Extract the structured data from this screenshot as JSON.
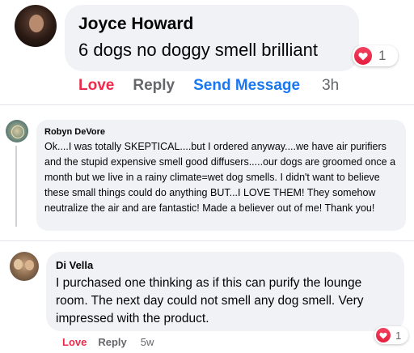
{
  "comments": [
    {
      "author": "Joyce Howard",
      "text": "6 dogs no doggy smell brilliant",
      "reaction_count": "1",
      "actions": {
        "love": "Love",
        "reply": "Reply",
        "send_message": "Send Message",
        "time": "3h"
      }
    },
    {
      "author": "Robyn DeVore",
      "text": "Ok....I was totally SKEPTICAL....but I ordered anyway....we have air purifiers and the stupid expensive smell good diffusers.....our dogs are groomed once a month but we live in a rainy climate=wet dog smells. I didn't want to believe these small things could do anything BUT...I LOVE THEM! They somehow neutralize the air and are fantastic! Made a believer out of me! Thank you!"
    },
    {
      "author": "Di Vella",
      "text": "I purchased one thinking as if this can purify the lounge room. The next day could not smell any dog smell. Very impressed with the product.",
      "reaction_count": "1",
      "actions": {
        "love": "Love",
        "reply": "Reply",
        "time": "5w"
      }
    }
  ],
  "colors": {
    "love": "#f02849",
    "link": "#1877f2",
    "secondary": "#65676b",
    "bubble": "#f0f2f5"
  },
  "icons": {
    "reaction": "heart-icon"
  }
}
